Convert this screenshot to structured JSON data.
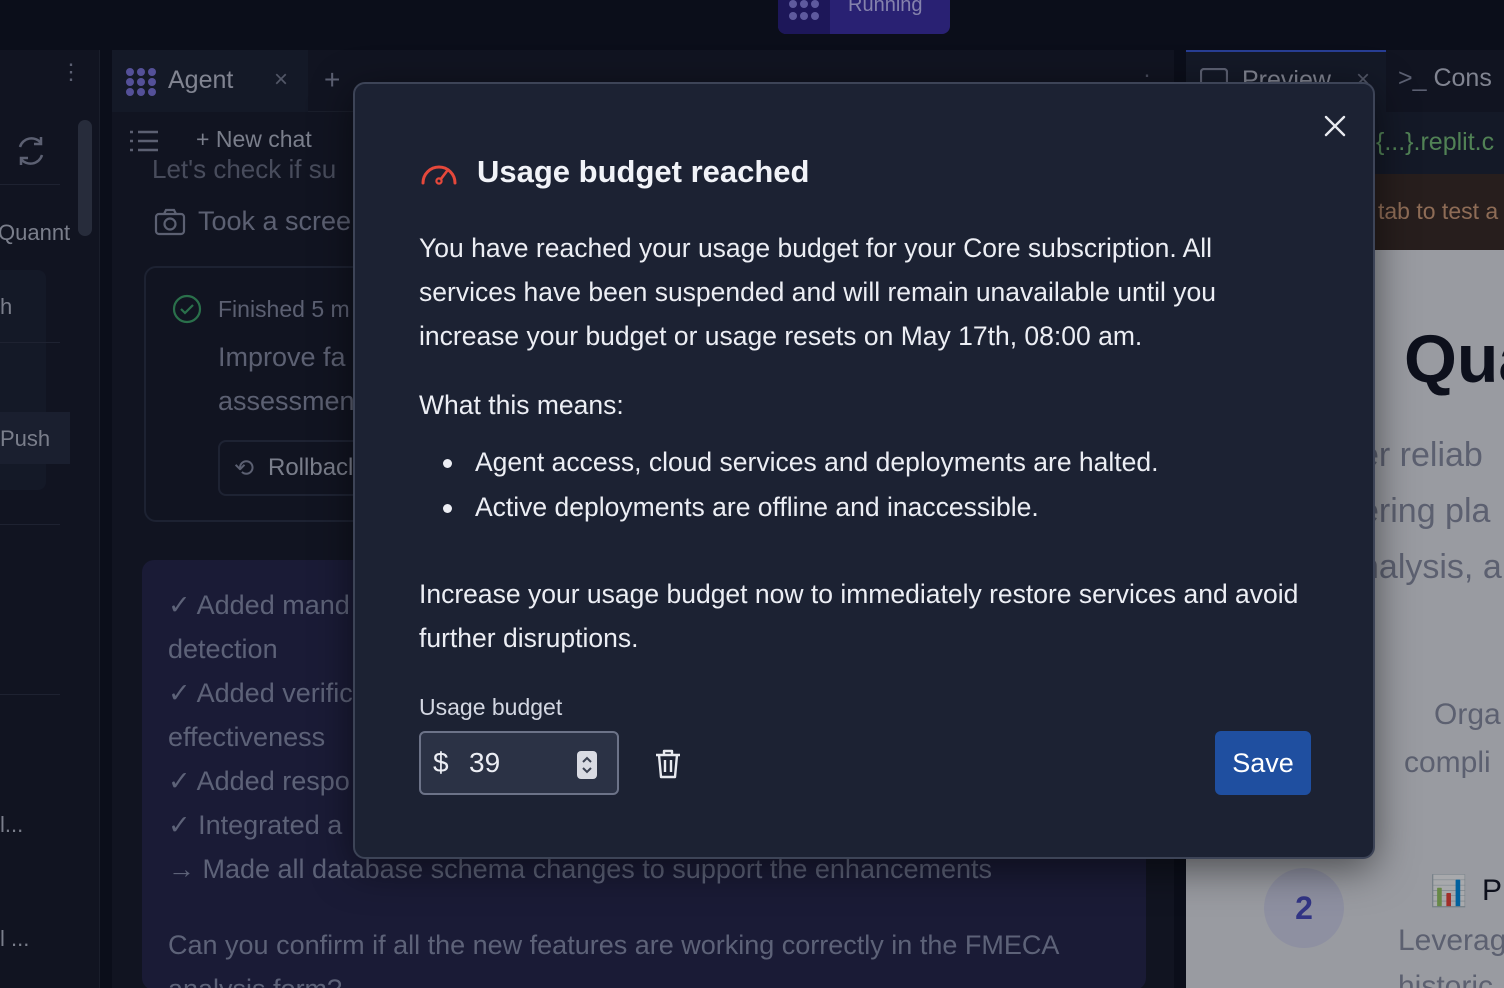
{
  "topbar": {
    "run_status": "Running"
  },
  "left_rail": {
    "texts": [
      "Quannt",
      "h",
      "Push",
      "l...",
      "l ..."
    ]
  },
  "agent_panel": {
    "tab_label": "Agent",
    "new_chat": "New chat",
    "chat_line_1": "Let's check if su",
    "screenshot_line": "Took a scree",
    "finished_line": "Finished 5 m",
    "improve_line_1": "Improve fa",
    "improve_line_2": "assessmen",
    "rollback_label": "Rollbacl",
    "summary": [
      "✓ Added mand",
      "detection",
      "✓ Added verific",
      "effectiveness",
      "✓ Added respo",
      "✓ Integrated a",
      "→ Made all database schema changes to support the enhancements",
      "Can you confirm if all the new features are working correctly in the FMECA",
      "analysis form?"
    ]
  },
  "preview_panel": {
    "preview_tab": "Preview",
    "console_tab": "Cons",
    "url_fragment": "{...}.replit.c",
    "warning_text": "tab to test a",
    "heading": "Qua",
    "lines": [
      "er reliab",
      "ering pla",
      "nalysis, a",
      "Orga",
      "compli",
      "Pr",
      "Leverag",
      "historic"
    ],
    "step_number": "2"
  },
  "modal": {
    "title": "Usage budget reached",
    "description": "You have reached your usage budget for your Core subscription. All services have been suspended and will remain unavailable until you increase your budget or usage resets on May 17th, 08:00 am.",
    "means_title": "What this means:",
    "means_items": [
      "Agent access, cloud services and deployments are halted.",
      "Active deployments are offline and inaccessible."
    ],
    "cta": "Increase your usage budget now to immediately restore services and avoid further disruptions.",
    "budget_label": "Usage budget",
    "currency_symbol": "$",
    "budget_value": "39",
    "save_label": "Save",
    "icons": {
      "header": "gauge-icon",
      "close": "close-icon",
      "delete": "trash-icon"
    },
    "colors": {
      "gauge": "#e5483b",
      "save": "#1f4fa0",
      "background": "#1c2233"
    }
  }
}
